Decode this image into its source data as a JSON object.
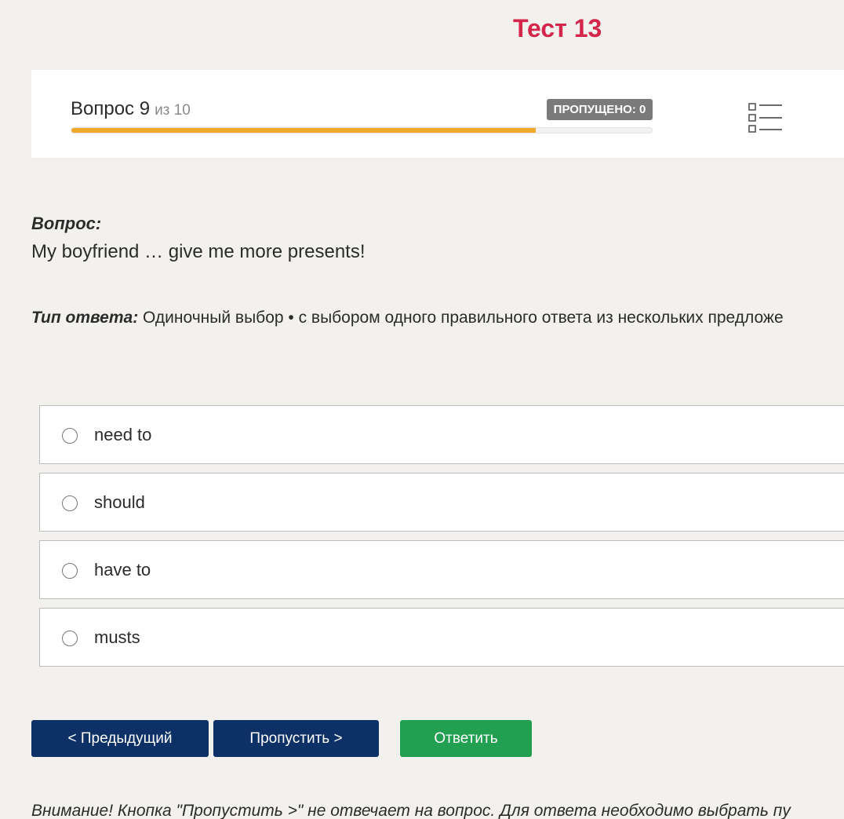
{
  "test": {
    "title": "Тест 13"
  },
  "progress": {
    "question_label": "Вопрос 9",
    "total_label": "из 10",
    "current": 9,
    "total": 10,
    "fill_fraction": 0.8,
    "skipped_label": "ПРОПУЩЕНО: 0",
    "accent_color": "#efa827",
    "list_icon": "list-icon"
  },
  "question": {
    "label": "Вопрос:",
    "text": "My boyfriend … give me more presents!",
    "answer_type_label": "Тип ответа:",
    "answer_type_value": "Одиночный выбор • с выбором одного правильного ответа из нескольких предложе"
  },
  "options": [
    {
      "label": "need to"
    },
    {
      "label": "should"
    },
    {
      "label": "have to"
    },
    {
      "label": "musts"
    }
  ],
  "buttons": {
    "prev_label": "< Предыдущий",
    "skip_label": "Пропустить >",
    "answer_label": "Ответить",
    "primary_color": "#0d3166",
    "answer_color": "#22a052"
  },
  "notice": {
    "text": "Внимание! Кнопка \"Пропустить >\" не отвечает на вопрос. Для ответа необходимо выбрать пу"
  },
  "colors": {
    "title": "#d3264a",
    "background": "#f2f1ee",
    "badge": "#7a7a7a"
  }
}
